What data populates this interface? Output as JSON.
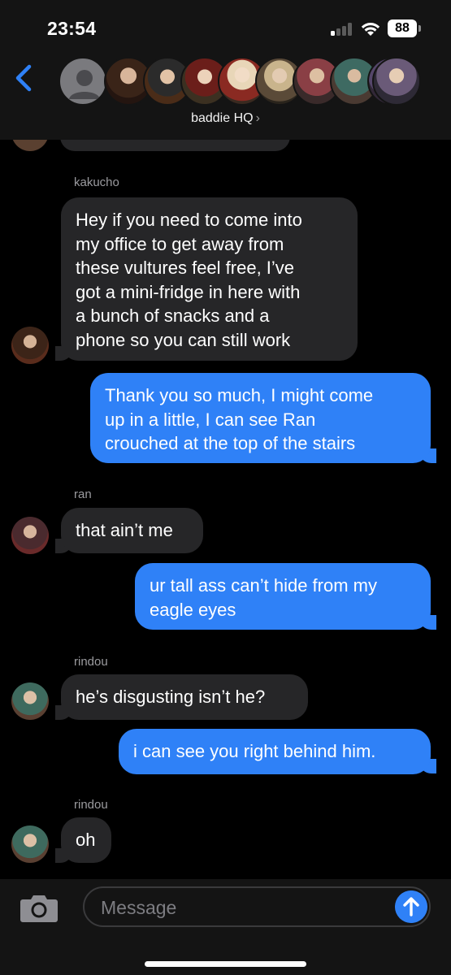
{
  "status_bar": {
    "time": "23:54",
    "battery": "88"
  },
  "header": {
    "group_name": "baddie HQ",
    "chevron": "›"
  },
  "messages": [
    {
      "sender": "kakucho",
      "text": "Hey if you need to come into\nmy office to get away from\nthese vultures feel free, I’ve\ngot a mini-fridge in here with\na bunch of snacks and a\nphone so you can still work"
    },
    {
      "text": "Thank you so much, I might come\nup in a little, I can see Ran\ncrouched at the top of the stairs"
    },
    {
      "sender": "ran",
      "text": "that ain’t me"
    },
    {
      "text": "ur tall ass can’t hide from my\neagle eyes"
    },
    {
      "sender": "rindou",
      "text": "he’s disgusting isn’t he?"
    },
    {
      "text": "i can see you right behind him."
    },
    {
      "sender": "rindou",
      "text": "oh"
    }
  ],
  "input": {
    "placeholder": "Message"
  },
  "colors": {
    "incoming": "#262628",
    "outgoing": "#2f81f7",
    "accent": "#2f81f7",
    "background": "#000000"
  },
  "icons": [
    "signal-icon",
    "wifi-icon",
    "battery-icon",
    "back-chevron-icon",
    "camera-icon",
    "send-arrow-icon"
  ]
}
